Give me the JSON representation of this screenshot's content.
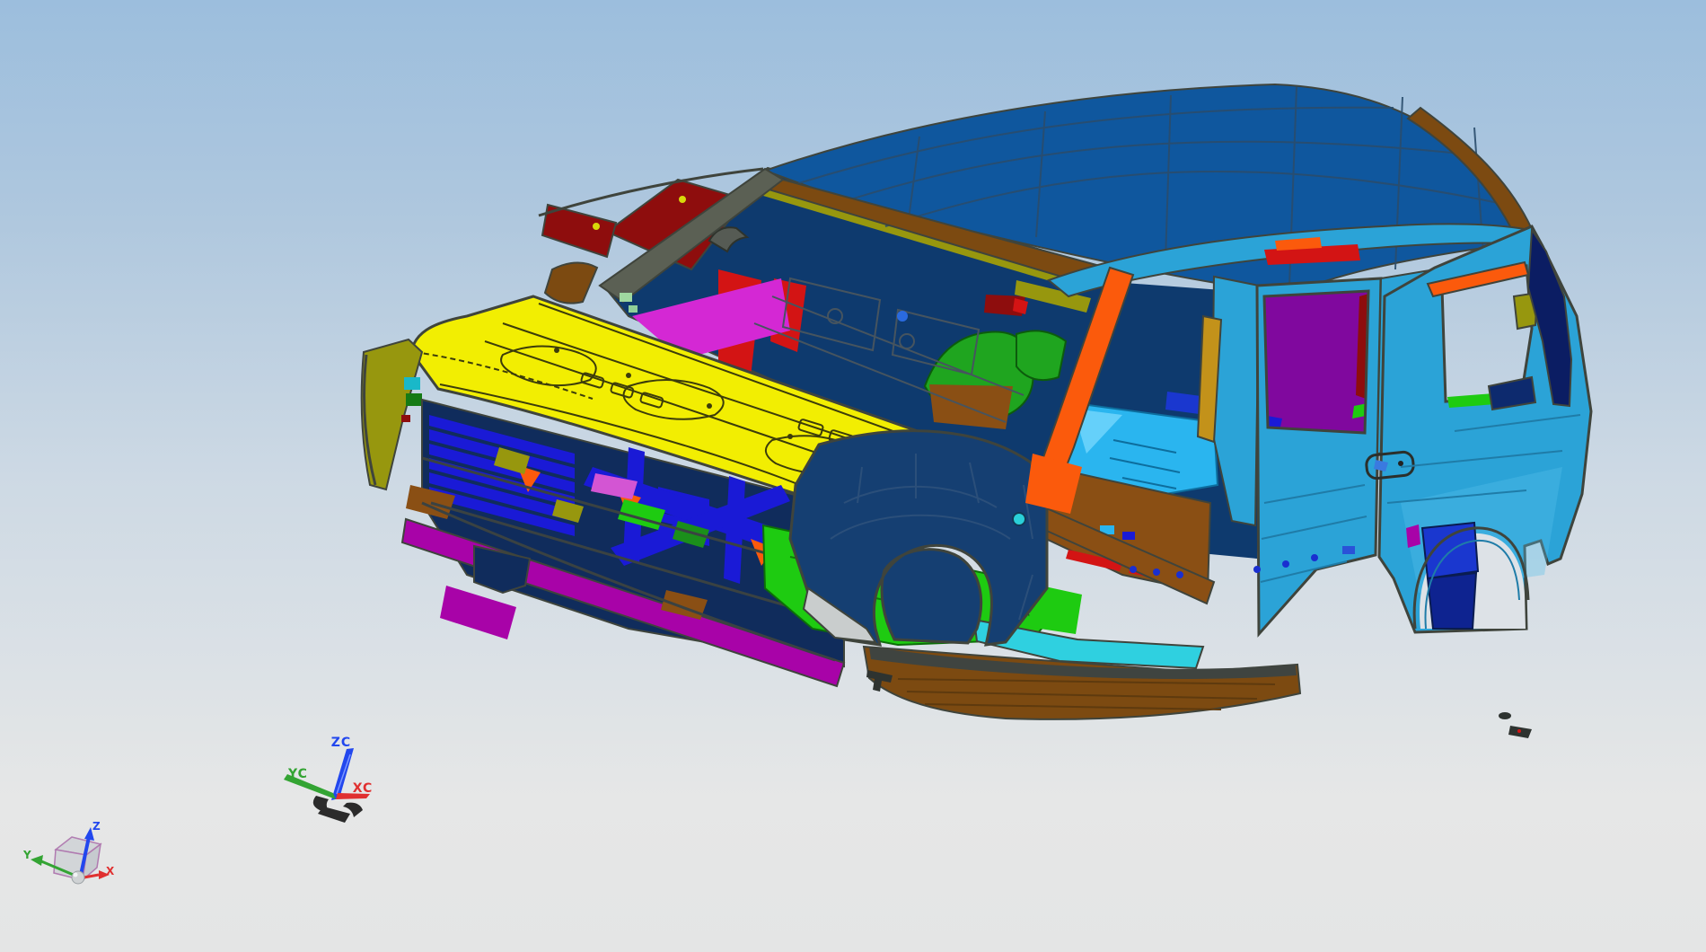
{
  "colors": {
    "bg_top": "#9cbedd",
    "bg_mid": "#cdd9e4",
    "bg_bottom": "#e6e7e7",
    "roof_blue": "#0f579e",
    "trim_brown": "#7c4a11",
    "body_cyan": "#2ba3d7",
    "body_cyan_light": "#55c0ea",
    "hood_yellow": "#f2ee02",
    "fender_navy": "#153f72",
    "interior_navy": "#0e3a6e",
    "front_navy": "#102c5c",
    "floor_green": "#1ecb11",
    "green_dark": "#1b8f1b",
    "floor_cyan": "#2ab5ef",
    "tunnel_brown": "#8a4f14",
    "struct_blue": "#1a1ad6",
    "magenta": "#a803a8",
    "magenta_bright": "#d428d4",
    "purple": "#80089e",
    "orange": "#fb5a0c",
    "gold": "#c3921a",
    "olive": "#97970e",
    "red": "#d31414",
    "dark_red": "#8e0d0d",
    "wheelbox_blue": "#1a37cf",
    "wheelbox_dark": "#0e2390",
    "window_navy": "#0b1d63",
    "rocker_cyan": "#2fd0e0",
    "gray_light": "#c9cdcd",
    "board_dark": "#3f4440",
    "fragment_dark": "#2e3330",
    "frame_gray": "#5b6054",
    "pink": "#d355d3",
    "mint": "#9fd8a0",
    "arch_bg": "#dde2e7",
    "axis_x": "#e03030",
    "axis_y": "#33a433",
    "axis_z": "#2247ee",
    "cube_edge": "#b07ab0",
    "cube_face": "#d2d5d8",
    "cube_face_dark": "#c6cacf",
    "sphere_gray": "#cfd2d4"
  },
  "wcs_triad": {
    "z": "ZC",
    "y": "YC",
    "x": "XC"
  },
  "view_triad": {
    "z": "Z",
    "y": "Y",
    "x": "X"
  }
}
